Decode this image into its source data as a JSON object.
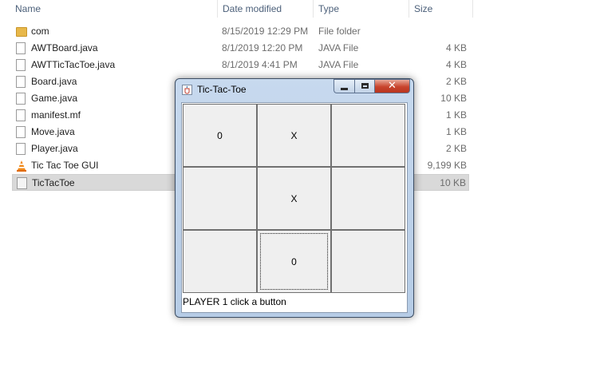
{
  "explorer": {
    "columns": {
      "name": "Name",
      "date": "Date modified",
      "type": "Type",
      "size": "Size"
    },
    "files": [
      {
        "name": "com",
        "date": "8/15/2019 12:29 PM",
        "type": "File folder",
        "size": "",
        "icon": "folder-icon"
      },
      {
        "name": "AWTBoard.java",
        "date": "8/1/2019 12:20 PM",
        "type": "JAVA File",
        "size": "4 KB",
        "icon": "file-icon"
      },
      {
        "name": "AWTTicTacToe.java",
        "date": "8/1/2019 4:41 PM",
        "type": "JAVA File",
        "size": "4 KB",
        "icon": "file-icon"
      },
      {
        "name": "Board.java",
        "date": "",
        "type": "",
        "size": "2 KB",
        "icon": "file-icon"
      },
      {
        "name": "Game.java",
        "date": "",
        "type": "",
        "size": "10 KB",
        "icon": "file-icon"
      },
      {
        "name": "manifest.mf",
        "date": "",
        "type": "",
        "size": "1 KB",
        "icon": "file-icon"
      },
      {
        "name": "Move.java",
        "date": "",
        "type": "",
        "size": "1 KB",
        "icon": "file-icon"
      },
      {
        "name": "Player.java",
        "date": "",
        "type": "",
        "size": "2 KB",
        "icon": "file-icon"
      },
      {
        "name": "Tic Tac Toe GUI",
        "date": "",
        "type": "",
        "size": "9,199 KB",
        "icon": "vlc-cone-icon"
      },
      {
        "name": "TicTacToe",
        "date": "",
        "type": "",
        "size": "10 KB",
        "icon": "executable-jar-icon",
        "selected": true
      }
    ]
  },
  "window": {
    "title": "Tic-Tac-Toe",
    "icon": "java-cup-icon",
    "controls": {
      "minimize": "minimize-icon",
      "maximize": "maximize-icon",
      "close": "close-icon"
    },
    "close_glyph": "✕",
    "board": [
      [
        "0",
        "X",
        ""
      ],
      [
        "",
        "X",
        ""
      ],
      [
        "",
        "0",
        ""
      ]
    ],
    "focused_cell": "2-1",
    "status": "PLAYER 1 click a button"
  }
}
